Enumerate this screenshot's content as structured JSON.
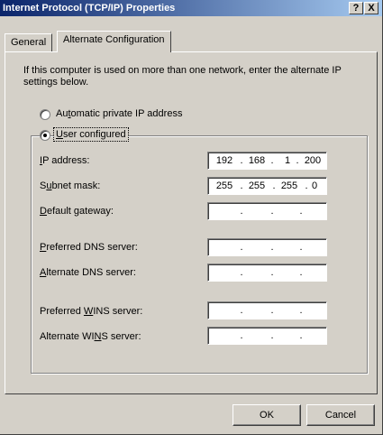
{
  "window": {
    "title": "Internet Protocol (TCP/IP) Properties",
    "help_button": "?",
    "close_button": "X"
  },
  "tabs": [
    {
      "label": "General",
      "active": false
    },
    {
      "label": "Alternate Configuration",
      "active": true
    }
  ],
  "intro_text": "If this computer is used on more than one network, enter the alternate IP settings below.",
  "options": {
    "automatic_label_pre": "Au",
    "automatic_label_u": "t",
    "automatic_label_post": "omatic private IP address",
    "automatic_selected": false,
    "user_label_u": "U",
    "user_label_post": "ser configured",
    "user_selected": true
  },
  "fields": {
    "ip_address": {
      "u": "I",
      "rest": "P address:",
      "octets": [
        "192",
        "168",
        "1",
        "200"
      ]
    },
    "subnet_mask": {
      "pre": "S",
      "u": "u",
      "rest": "bnet mask:",
      "octets": [
        "255",
        "255",
        "255",
        "0"
      ]
    },
    "default_gateway": {
      "u": "D",
      "rest": "efault gateway:",
      "octets": [
        "",
        "",
        "",
        ""
      ]
    },
    "preferred_dns": {
      "u": "P",
      "rest": "referred DNS server:",
      "octets": [
        "",
        "",
        "",
        ""
      ]
    },
    "alternate_dns": {
      "u": "A",
      "rest": "lternate DNS server:",
      "octets": [
        "",
        "",
        "",
        ""
      ]
    },
    "preferred_wins": {
      "pre": "Preferred ",
      "u": "W",
      "rest": "INS server:",
      "octets": [
        "",
        "",
        "",
        ""
      ]
    },
    "alternate_wins": {
      "pre": "Alternate WI",
      "u": "N",
      "rest": "S server:",
      "octets": [
        "",
        "",
        "",
        ""
      ]
    }
  },
  "buttons": {
    "ok": "OK",
    "cancel": "Cancel"
  },
  "colors": {
    "dialog_face": "#d4d0c8",
    "title_gradient_start": "#0a246a",
    "title_gradient_end": "#a6caf0"
  }
}
